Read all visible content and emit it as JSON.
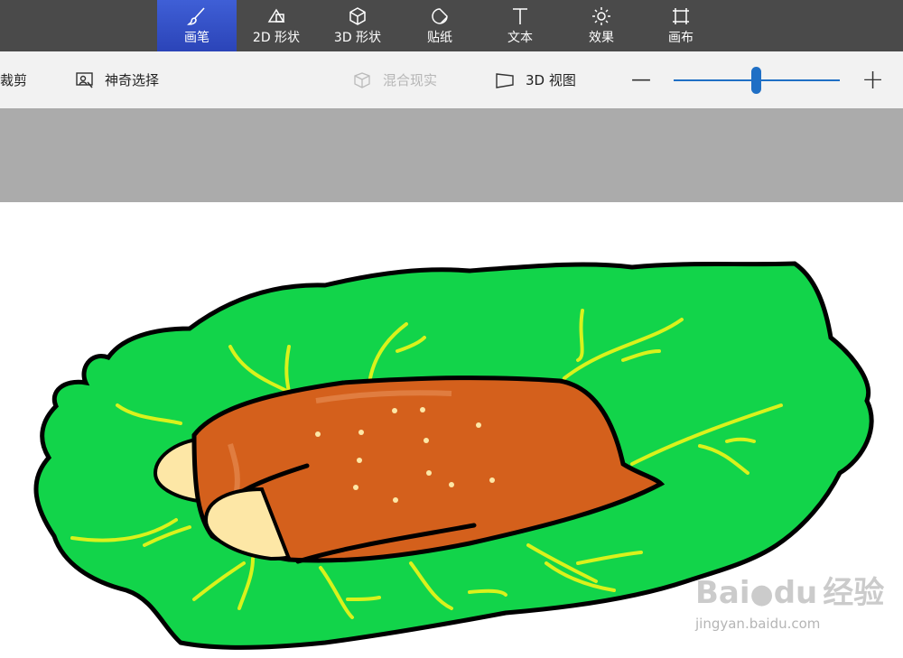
{
  "tabs": [
    {
      "label": "画笔",
      "icon": "brush-icon",
      "active": true
    },
    {
      "label": "2D 形状",
      "icon": "2d-shapes-icon",
      "active": false
    },
    {
      "label": "3D 形状",
      "icon": "3d-shapes-icon",
      "active": false
    },
    {
      "label": "贴纸",
      "icon": "sticker-icon",
      "active": false
    },
    {
      "label": "文本",
      "icon": "text-icon",
      "active": false
    },
    {
      "label": "效果",
      "icon": "effects-icon",
      "active": false
    },
    {
      "label": "画布",
      "icon": "canvas-icon",
      "active": false
    }
  ],
  "toolbar": {
    "crop_label": "裁剪",
    "magic_select_label": "神奇选择",
    "mixed_reality_label": "混合现实",
    "view3d_label": "3D 视图",
    "zoom_out": "—",
    "zoom_in": "+"
  },
  "zoom": {
    "level": 0.5
  },
  "colors": {
    "topbar": "#4a4a4a",
    "active_tab": "#2f4cc4",
    "leaf": "#12d44a",
    "veins": "#d9f21c",
    "meat": "#d4601c",
    "bone": "#fde7a6",
    "outline": "#000000"
  },
  "watermark": {
    "brand": "Bai",
    "brand2": "du",
    "cn": "经验",
    "url": "jingyan.baidu.com"
  }
}
